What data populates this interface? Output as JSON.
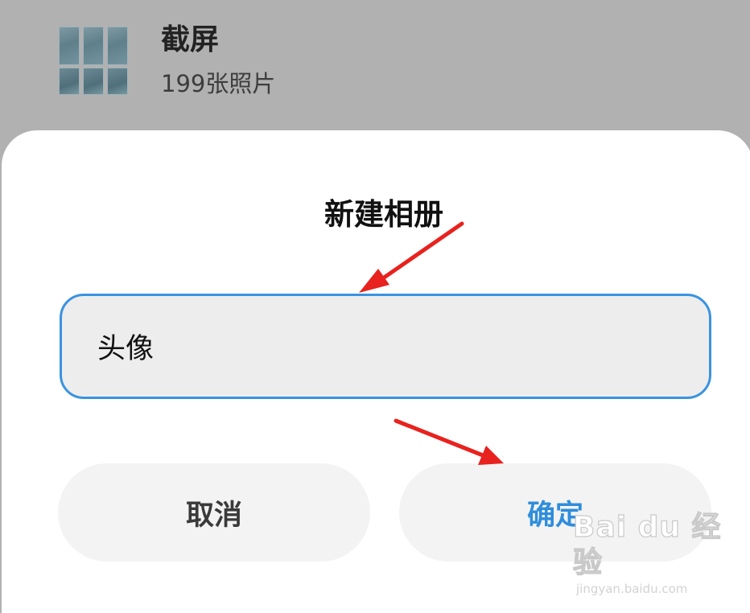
{
  "background_album": {
    "name": "截屏",
    "count_text": "199张照片",
    "thumbnail_icon": "album-thumbnail-grid"
  },
  "dialog": {
    "title": "新建相册",
    "input": {
      "value": "头像"
    },
    "cancel_label": "取消",
    "confirm_label": "确定"
  },
  "watermark": {
    "logo_text": "Bai du 经验",
    "url": "jingyan.baidu.com"
  },
  "colors": {
    "accent": "#2f8ddb",
    "input_border": "#3a93e0",
    "annotation_arrow": "#e8221e",
    "overlay_background": "#b1b1b1"
  }
}
